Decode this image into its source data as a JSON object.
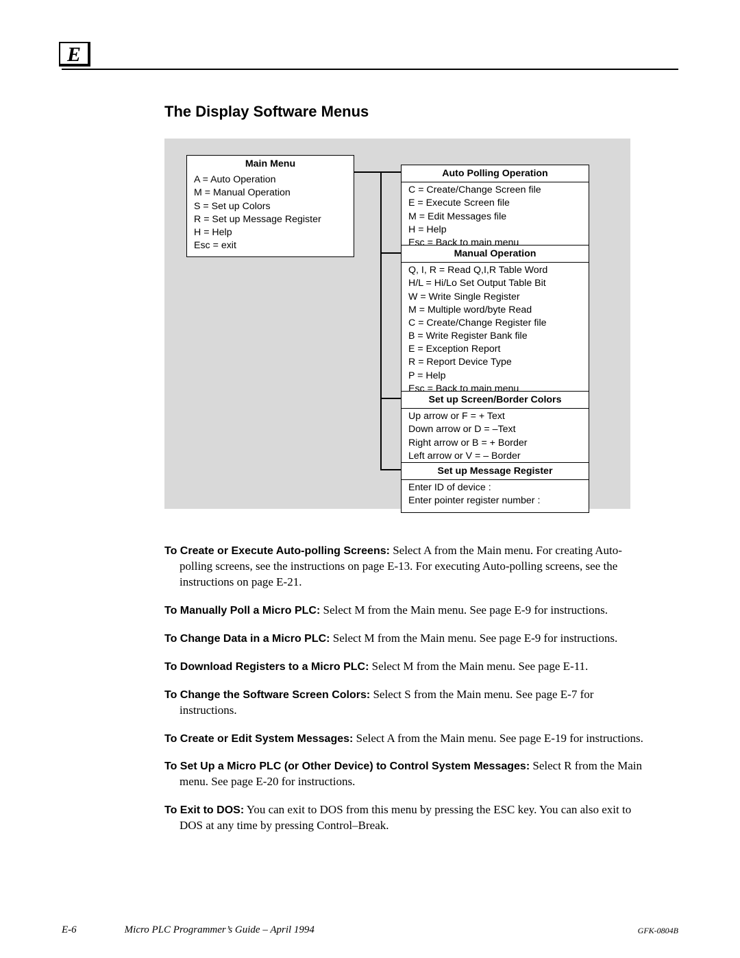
{
  "header": {
    "letter": "E"
  },
  "section_title": "The Display Software Menus",
  "menus": {
    "main": {
      "title": "Main Menu",
      "items": [
        "A = Auto Operation",
        "M = Manual Operation",
        "S = Set up Colors",
        "R = Set up Message Register",
        "H = Help",
        "Esc = exit"
      ]
    },
    "auto": {
      "title": "Auto Polling Operation",
      "items": [
        "C = Create/Change Screen file",
        "E = Execute Screen file",
        "M = Edit Messages file",
        "H = Help",
        "Esc = Back to main menu"
      ]
    },
    "manual": {
      "title": "Manual Operation",
      "items": [
        "Q, I, R = Read Q,I,R Table Word",
        "H/L = Hi/Lo Set Output Table Bit",
        "W = Write Single Register",
        "M = Multiple word/byte Read",
        "C = Create/Change Register file",
        "B = Write Register Bank file",
        "E = Exception Report",
        "R = Report Device Type",
        "P = Help",
        "Esc = Back to main menu"
      ]
    },
    "colors": {
      "title": "Set up Screen/Border Colors",
      "items": [
        "Up arrow or F = + Text",
        "Down arrow or D = –Text",
        "Right arrow or B = + Border",
        "Left arrow or V = – Border"
      ]
    },
    "msgreg": {
      "title": "Set up Message Register",
      "items": [
        "Enter ID of device :",
        "Enter pointer register number :"
      ]
    }
  },
  "instructions": [
    {
      "lead": "To Create or Execute Auto-polling Screens:",
      "body": "  Select A from the Main menu. For creating Auto-polling screens, see the instructions on page E-13. For executing Auto-polling screens, see the instructions on page E-21."
    },
    {
      "lead": "To Manually Poll a Micro PLC:",
      "body": "  Select M from the Main menu. See page E-9 for instructions."
    },
    {
      "lead": "To Change Data in a Micro PLC:",
      "body": "  Select M from the Main menu. See page E-9 for instructions."
    },
    {
      "lead": "To Download Registers to a Micro PLC:",
      "body": "  Select M from the Main menu. See page E-11."
    },
    {
      "lead": "To Change the Software Screen Colors:",
      "body": "  Select S from the Main menu. See page E-7 for instructions."
    },
    {
      "lead": "To Create or Edit System Messages:",
      "body": "  Select A from the Main menu. See page E-19 for instructions."
    },
    {
      "lead": "To Set Up a Micro PLC (or Other Device) to Control System Messages:",
      "body": "  Select R from the Main menu. See page E-20 for instructions."
    },
    {
      "lead": "To Exit to DOS:",
      "body": "  You can exit to DOS from this menu by pressing the ESC key. You can also exit to DOS at any time by pressing Control–Break."
    }
  ],
  "footer": {
    "page": "E-6",
    "title": "Micro PLC Programmer’s Guide – April 1994",
    "doc": "GFK-0804B"
  }
}
